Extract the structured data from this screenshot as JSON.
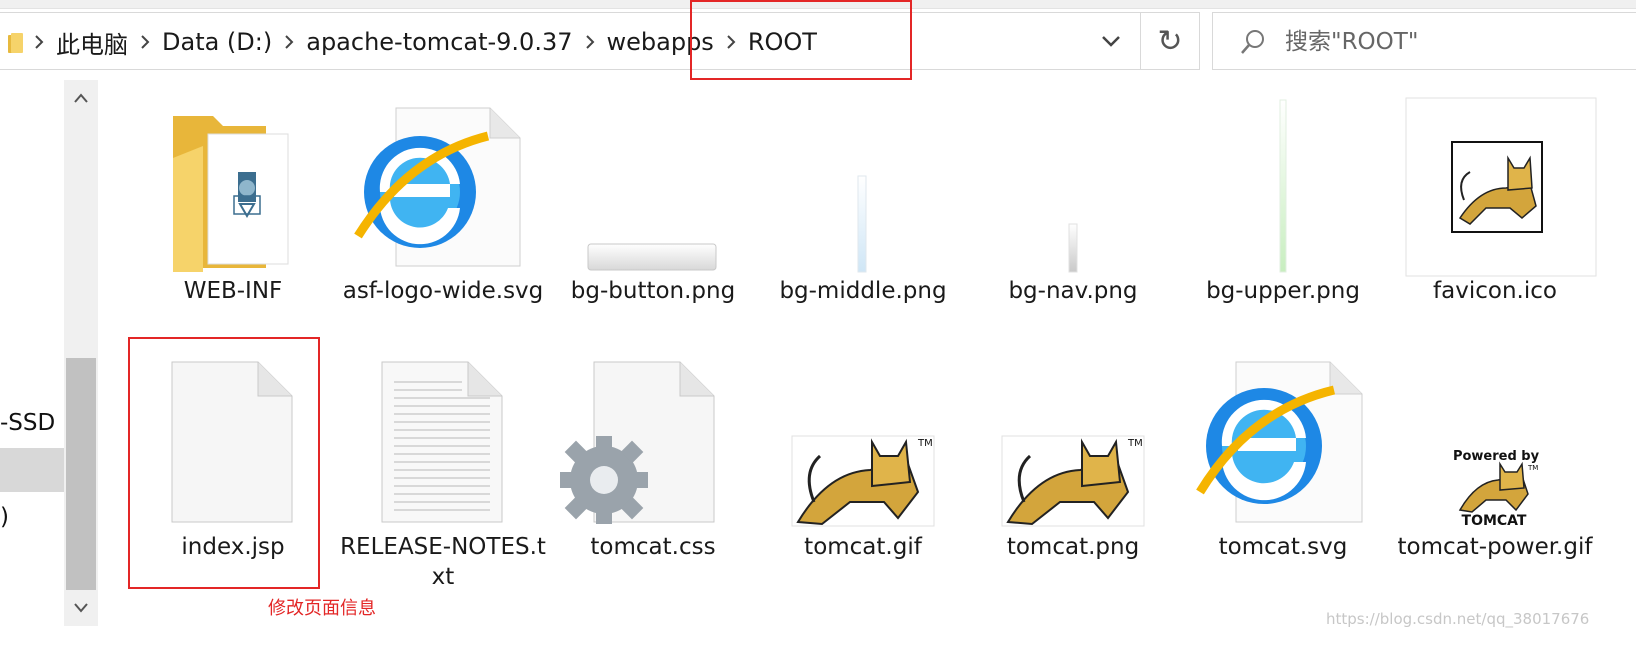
{
  "address_bar": {
    "crumbs": [
      "此电脑",
      "Data (D:)",
      "apache-tomcat-9.0.37",
      "webapps",
      "ROOT"
    ]
  },
  "search": {
    "placeholder": "搜索\"ROOT\""
  },
  "nav_pane": {
    "visible_items": [
      "-SSD (",
      ")"
    ]
  },
  "files": [
    {
      "name": "WEB-INF",
      "icon": "folder-icon"
    },
    {
      "name": "asf-logo-wide.svg",
      "icon": "internet-explorer-icon"
    },
    {
      "name": "bg-button.png",
      "icon": "image-thumbnail-icon"
    },
    {
      "name": "bg-middle.png",
      "icon": "image-thumbnail-icon"
    },
    {
      "name": "bg-nav.png",
      "icon": "image-thumbnail-icon"
    },
    {
      "name": "bg-upper.png",
      "icon": "image-thumbnail-icon"
    },
    {
      "name": "favicon.ico",
      "icon": "tomcat-logo-icon"
    },
    {
      "name": "index.jsp",
      "icon": "blank-document-icon"
    },
    {
      "name": "RELEASE-NOTES.txt",
      "icon": "text-document-icon"
    },
    {
      "name": "tomcat.css",
      "icon": "gear-document-icon"
    },
    {
      "name": "tomcat.gif",
      "icon": "tomcat-logo-icon"
    },
    {
      "name": "tomcat.png",
      "icon": "tomcat-logo-icon"
    },
    {
      "name": "tomcat.svg",
      "icon": "internet-explorer-icon"
    },
    {
      "name": "tomcat-power.gif",
      "icon": "powered-by-tomcat-icon"
    }
  ],
  "powered_by": {
    "line1": "Powered by",
    "line2": "TOMCAT",
    "tm": "TM"
  },
  "annotation": "修改页面信息",
  "watermark": "https://blog.csdn.net/qq_38017676",
  "colors": {
    "highlight_box": "#e32626",
    "folder": "#f6d36a",
    "ie_blue": "#1e88e5"
  }
}
